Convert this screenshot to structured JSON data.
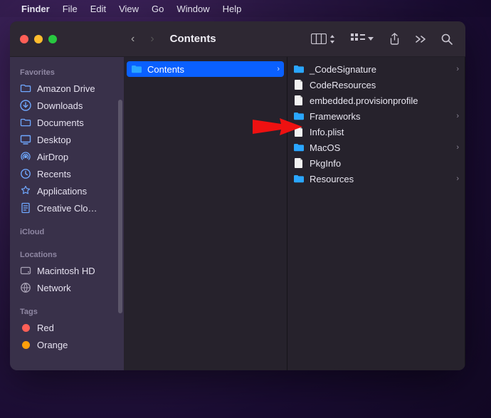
{
  "menubar": {
    "app": "Finder",
    "items": [
      "File",
      "Edit",
      "View",
      "Go",
      "Window",
      "Help"
    ]
  },
  "window": {
    "title": "Contents"
  },
  "sidebar": {
    "sections": [
      {
        "header": "Favorites",
        "items": [
          {
            "icon": "folder",
            "label": "Amazon Drive"
          },
          {
            "icon": "download",
            "label": "Downloads"
          },
          {
            "icon": "folder",
            "label": "Documents"
          },
          {
            "icon": "desktop",
            "label": "Desktop"
          },
          {
            "icon": "airdrop",
            "label": "AirDrop"
          },
          {
            "icon": "clock",
            "label": "Recents"
          },
          {
            "icon": "apps",
            "label": "Applications"
          },
          {
            "icon": "document",
            "label": "Creative Clo…"
          }
        ]
      },
      {
        "header": "iCloud",
        "items": []
      },
      {
        "header": "Locations",
        "items": [
          {
            "icon": "disk",
            "label": "Macintosh HD"
          },
          {
            "icon": "globe",
            "label": "Network"
          }
        ]
      },
      {
        "header": "Tags",
        "items": [
          {
            "icon": "tag",
            "color": "#ff5f57",
            "label": "Red"
          },
          {
            "icon": "tag",
            "color": "#ff9f0a",
            "label": "Orange"
          }
        ]
      }
    ]
  },
  "columns": [
    {
      "items": [
        {
          "icon": "folder",
          "label": "Contents",
          "hasChildren": true,
          "selected": true
        }
      ]
    },
    {
      "items": [
        {
          "icon": "folder",
          "label": "_CodeSignature",
          "hasChildren": true
        },
        {
          "icon": "document",
          "label": "CodeResources"
        },
        {
          "icon": "document",
          "label": "embedded.provisionprofile"
        },
        {
          "icon": "folder",
          "label": "Frameworks",
          "hasChildren": true
        },
        {
          "icon": "document",
          "label": "Info.plist"
        },
        {
          "icon": "folder",
          "label": "MacOS",
          "hasChildren": true
        },
        {
          "icon": "document",
          "label": "PkgInfo"
        },
        {
          "icon": "folder",
          "label": "Resources",
          "hasChildren": true
        }
      ]
    }
  ],
  "annotation": {
    "target": "Info.plist"
  }
}
